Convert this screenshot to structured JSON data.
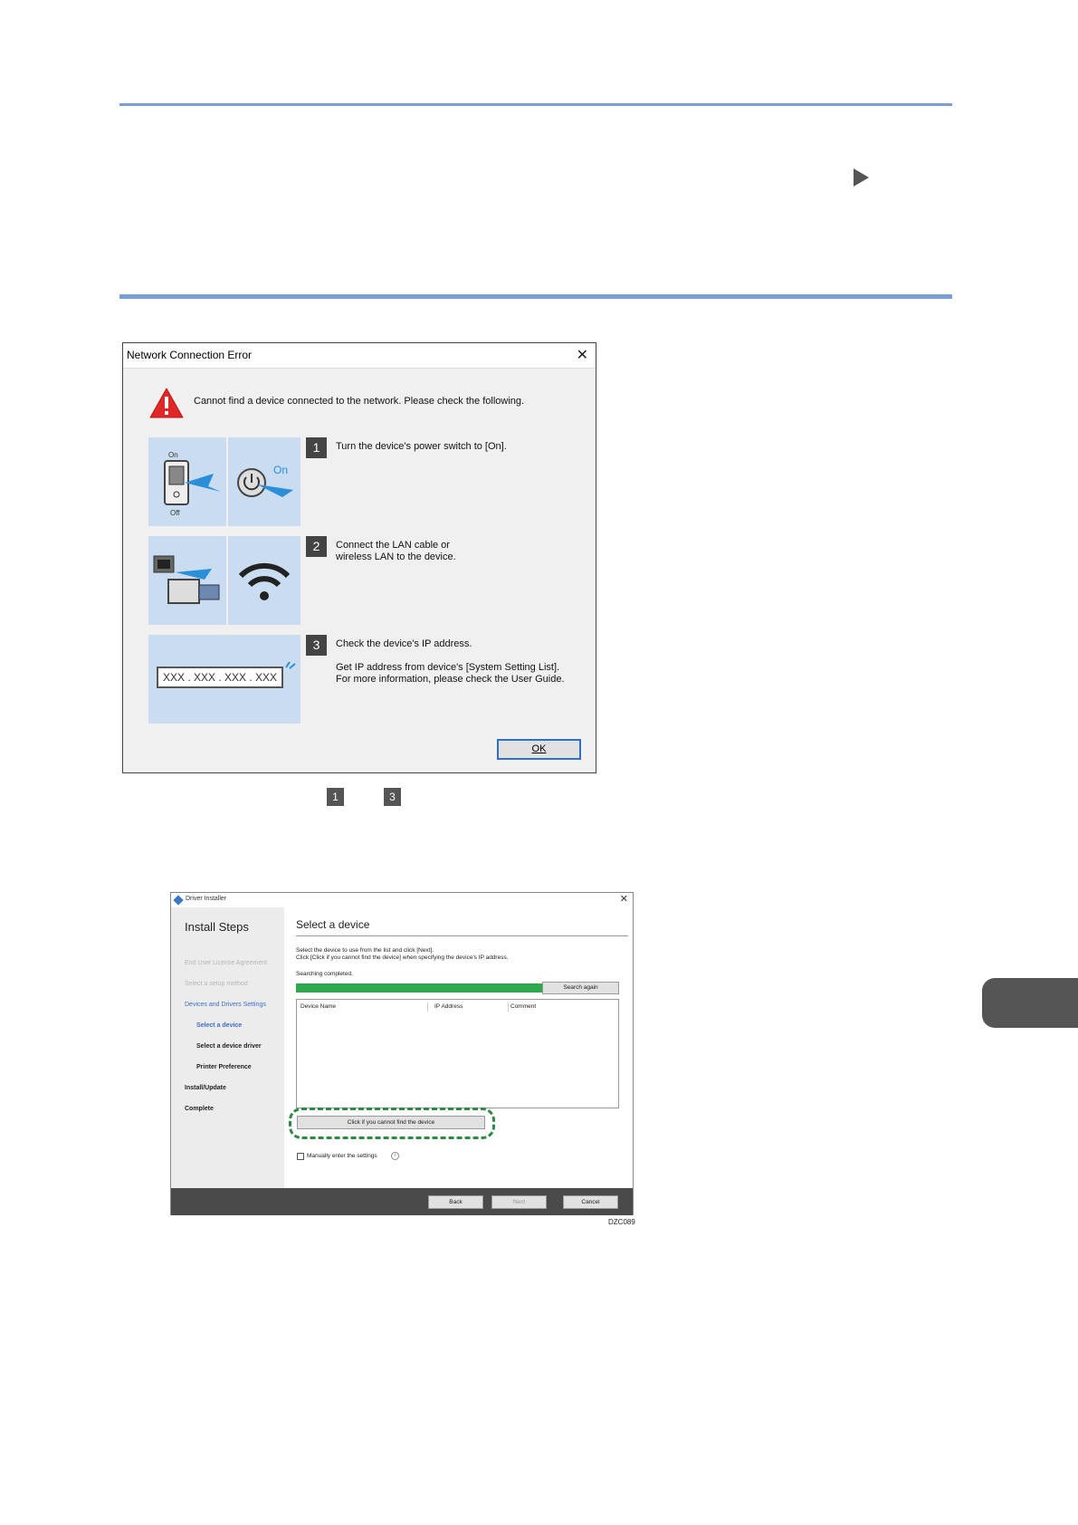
{
  "dialog1": {
    "title": "Network Connection Error",
    "message": "Cannot find a device connected to the network. Please check the following.",
    "steps": [
      {
        "number": "1",
        "text_lines": [
          "Turn the device's power switch to [On]."
        ]
      },
      {
        "number": "2",
        "text_lines": [
          "Connect the LAN cable or",
          "wireless LAN to the device."
        ]
      },
      {
        "number": "3",
        "text_lines": [
          "Check the device's IP address."
        ]
      }
    ],
    "step3_extra": [
      "Get IP address from device's [System Setting List].",
      "For more information, please check the User Guide."
    ],
    "switch_on_label": "On",
    "switch_off_label": "Off",
    "power_on_label": "On",
    "ip_placeholder": "XXX . XXX . XXX . XXX",
    "ok_button": "OK"
  },
  "step_refs": [
    "1",
    "3"
  ],
  "dialog2": {
    "window_title": "Driver Installer",
    "sidebar": {
      "heading": "Install Steps",
      "items": [
        "End User License Agreement",
        "Select a setup method",
        "Devices and Drivers Settings",
        "Select a device",
        "Select a device driver",
        "Printer Preference",
        "Install/Update",
        "Complete"
      ]
    },
    "main_title": "Select a device",
    "instructions": [
      "Select the device to use from the list and click [Next].",
      "Click [Click if you cannot find the device] when specifying the device's IP address."
    ],
    "status": "Searching completed.",
    "progress": 1.0,
    "search_again": "Search again",
    "columns": [
      "Device Name",
      "IP Address",
      "Comment"
    ],
    "cannot_find_button": "Click if you cannot find the device",
    "manual_checkbox": "Manually enter the settings",
    "footer_buttons": {
      "back": "Back",
      "next": "Next",
      "cancel": "Cancel"
    }
  },
  "figure_code": "DZC089",
  "colors": {
    "accent_rule": "#7a9ed6",
    "progress": "#2fa84f",
    "highlight_dash": "#2c8a45",
    "ok_border": "#2f6fc9"
  }
}
